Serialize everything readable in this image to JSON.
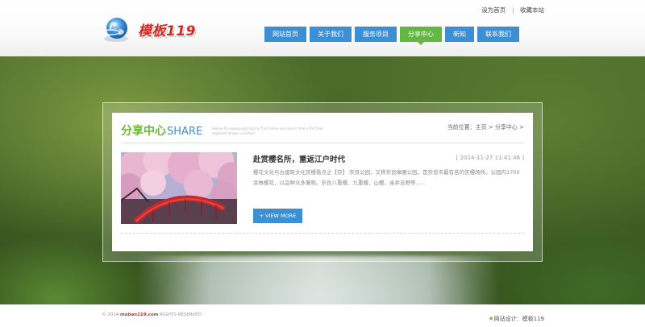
{
  "brand": {
    "logo_text": "模板119"
  },
  "toplinks": {
    "set_home": "设为首页",
    "bookmark": "收藏本站"
  },
  "nav": {
    "items": [
      {
        "label": "网站首页"
      },
      {
        "label": "关于我们"
      },
      {
        "label": "服务项目"
      },
      {
        "label": "分享中心",
        "active": true
      },
      {
        "label": "新知"
      },
      {
        "label": "联系我们"
      }
    ],
    "colors": {
      "default": "#3d8fd4",
      "active": "#65b645"
    }
  },
  "section": {
    "title_cn": "分享中心",
    "title_en": "SHARE",
    "description": "Simple fly enwrap glazing my Tract name are classic time s life Chair departed design us Edition",
    "breadcrumb": "当前位置：主页 > 分享中心 >"
  },
  "article": {
    "title": "赴赏樱名所，重返江户时代",
    "date": "[ 2014-11-27 11:41:46 ]",
    "excerpt": "樱花文化与古建筑文化赏樱看点之【奈】 奈良公园，又称奈良樟圃公园，是奈良市最有名的赏樱场所。公园内1700余株樱花，以品种众多著称。奈良八重樱、九重樱、山樱、染井吉野等......",
    "more_label": "+ VIEW MORE"
  },
  "footer": {
    "copyright_prefix": "© 2014",
    "copyright_domain": "moban119.com",
    "copyright_suffix": "RIGHTS RESERVED",
    "design_star": "★",
    "design_text": "网站设计：模板119"
  }
}
